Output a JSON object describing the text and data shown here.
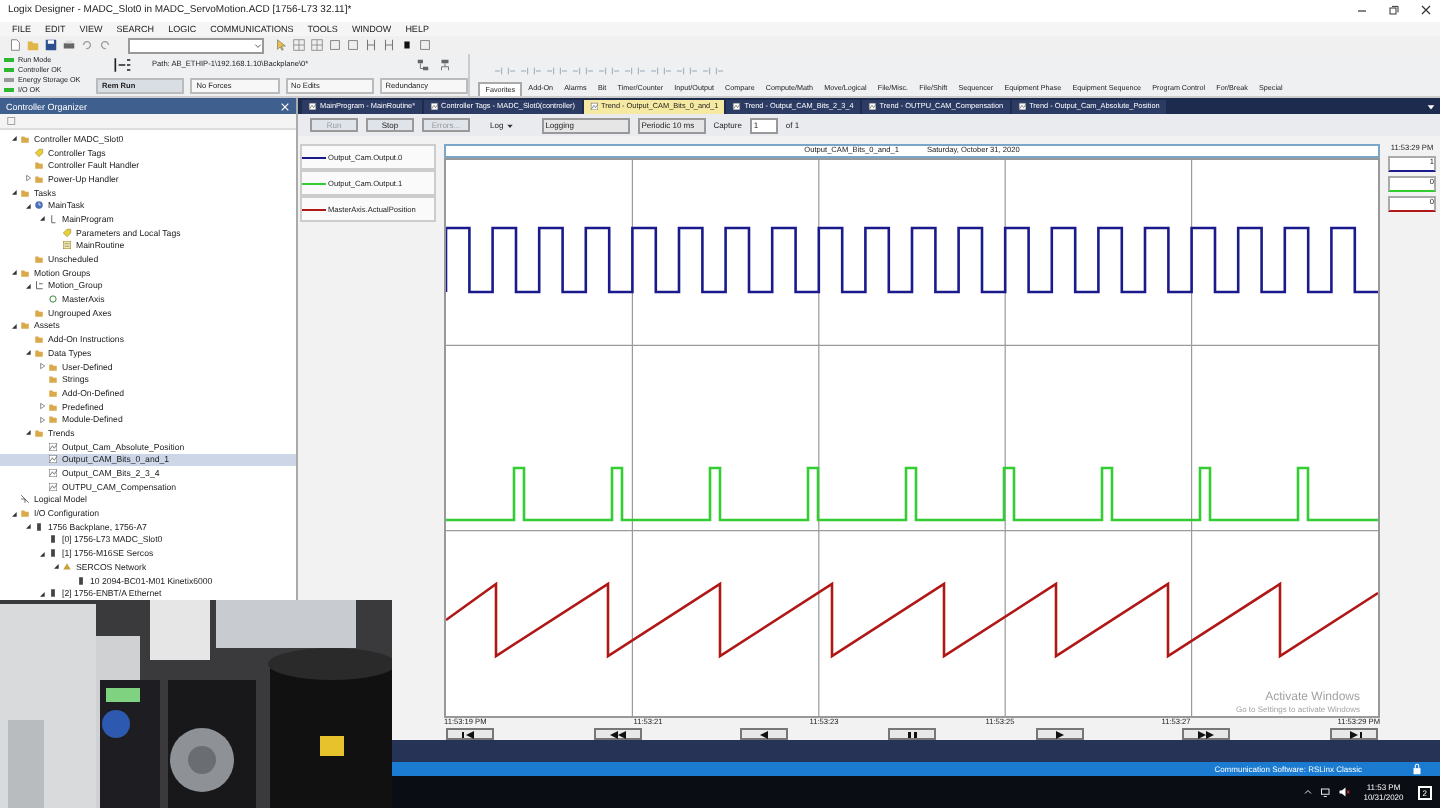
{
  "window": {
    "title": "Logix Designer - MADC_Slot0 in MADC_ServoMotion.ACD [1756-L73 32.11]*"
  },
  "menu": [
    "FILE",
    "EDIT",
    "VIEW",
    "SEARCH",
    "LOGIC",
    "COMMUNICATIONS",
    "TOOLS",
    "WINDOW",
    "HELP"
  ],
  "controller_status": [
    {
      "label": "Run Mode",
      "on": true
    },
    {
      "label": "Controller OK",
      "on": true
    },
    {
      "label": "Energy Storage OK",
      "on": false
    },
    {
      "label": "I/O OK",
      "on": true
    }
  ],
  "path": "Path: AB_ETHIP-1\\192.168.1.10\\Backplane\\0*",
  "mode_indicators": [
    "Rem Run",
    "No Forces",
    "No Edits",
    "Redundancy"
  ],
  "instruction_tabs": [
    {
      "label": "Favorites",
      "selected": true
    },
    {
      "label": "Add-On",
      "selected": false
    },
    {
      "label": "Alarms",
      "selected": false
    },
    {
      "label": "Bit",
      "selected": false
    },
    {
      "label": "Timer/Counter",
      "selected": false
    },
    {
      "label": "Input/Output",
      "selected": false
    },
    {
      "label": "Compare",
      "selected": false
    },
    {
      "label": "Compute/Math",
      "selected": false
    },
    {
      "label": "Move/Logical",
      "selected": false
    },
    {
      "label": "File/Misc.",
      "selected": false
    },
    {
      "label": "File/Shift",
      "selected": false
    },
    {
      "label": "Sequencer",
      "selected": false
    },
    {
      "label": "Equipment Phase",
      "selected": false
    },
    {
      "label": "Equipment Sequence",
      "selected": false
    },
    {
      "label": "Program Control",
      "selected": false
    },
    {
      "label": "For/Break",
      "selected": false
    },
    {
      "label": "Special",
      "selected": false
    }
  ],
  "organizer": {
    "title": "Controller Organizer",
    "tree": [
      {
        "label": "Controller MADC_Slot0",
        "kind": "folder",
        "expanded": true,
        "selected": false,
        "children": [
          {
            "label": "Controller Tags",
            "kind": "tags",
            "selected": false
          },
          {
            "label": "Controller Fault Handler",
            "kind": "folder",
            "selected": false
          },
          {
            "label": "Power-Up Handler",
            "kind": "folder",
            "expanded": false,
            "selected": false
          }
        ]
      },
      {
        "label": "Tasks",
        "kind": "folder",
        "expanded": true,
        "selected": false,
        "children": [
          {
            "label": "MainTask",
            "kind": "task",
            "expanded": true,
            "selected": false,
            "children": [
              {
                "label": "MainProgram",
                "kind": "program",
                "expanded": true,
                "selected": false,
                "children": [
                  {
                    "label": "Parameters and Local Tags",
                    "kind": "tags",
                    "selected": false
                  },
                  {
                    "label": "MainRoutine",
                    "kind": "routine",
                    "selected": false
                  }
                ]
              }
            ]
          },
          {
            "label": "Unscheduled",
            "kind": "folder",
            "selected": false
          }
        ]
      },
      {
        "label": "Motion Groups",
        "kind": "folder",
        "expanded": true,
        "selected": false,
        "children": [
          {
            "label": "Motion_Group",
            "kind": "group",
            "expanded": true,
            "selected": false,
            "children": [
              {
                "label": "MasterAxis",
                "kind": "axis",
                "selected": false
              }
            ]
          },
          {
            "label": "Ungrouped Axes",
            "kind": "folder",
            "selected": false
          }
        ]
      },
      {
        "label": "Assets",
        "kind": "folder",
        "expanded": true,
        "selected": false,
        "children": [
          {
            "label": "Add-On Instructions",
            "kind": "folder",
            "selected": false
          },
          {
            "label": "Data Types",
            "kind": "folder",
            "expanded": true,
            "selected": false,
            "children": [
              {
                "label": "User-Defined",
                "kind": "folder",
                "expanded": false,
                "selected": false
              },
              {
                "label": "Strings",
                "kind": "folder",
                "selected": false
              },
              {
                "label": "Add-On-Defined",
                "kind": "folder",
                "selected": false
              },
              {
                "label": "Predefined",
                "kind": "folder",
                "expanded": false,
                "selected": false
              },
              {
                "label": "Module-Defined",
                "kind": "folder",
                "expanded": false,
                "selected": false
              }
            ]
          },
          {
            "label": "Trends",
            "kind": "folder",
            "expanded": true,
            "selected": false,
            "children": [
              {
                "label": "Output_Cam_Absolute_Position",
                "kind": "trend",
                "selected": false
              },
              {
                "label": "Output_CAM_Bits_0_and_1",
                "kind": "trend",
                "selected": true
              },
              {
                "label": "Output_CAM_Bits_2_3_4",
                "kind": "trend",
                "selected": false
              },
              {
                "label": "OUTPU_CAM_Compensation",
                "kind": "trend",
                "selected": false
              }
            ]
          }
        ]
      },
      {
        "label": "Logical Model",
        "kind": "model",
        "selected": false
      },
      {
        "label": "I/O Configuration",
        "kind": "folder",
        "expanded": true,
        "selected": false,
        "children": [
          {
            "label": "1756 Backplane, 1756-A7",
            "kind": "module",
            "expanded": true,
            "selected": false,
            "children": [
              {
                "label": "[0] 1756-L73 MADC_Slot0",
                "kind": "module",
                "selected": false
              },
              {
                "label": "[1] 1756-M16SE Sercos",
                "kind": "module",
                "expanded": true,
                "selected": false,
                "children": [
                  {
                    "label": "SERCOS Network",
                    "kind": "network",
                    "expanded": true,
                    "selected": false,
                    "children": [
                      {
                        "label": "10 2094-BC01-M01 Kinetix6000",
                        "kind": "module",
                        "selected": false
                      }
                    ]
                  }
                ]
              },
              {
                "label": "[2] 1756-ENBT/A Ethernet",
                "kind": "module",
                "expanded": true,
                "selected": false
              }
            ]
          }
        ]
      }
    ]
  },
  "editor_tabs": [
    {
      "label": "MainProgram - MainRoutine*",
      "selected": false
    },
    {
      "label": "Controller Tags - MADC_Slot0(controller)",
      "selected": false
    },
    {
      "label": "Trend - Output_CAM_Bits_0_and_1",
      "selected": true
    },
    {
      "label": "Trend - Output_CAM_Bits_2_3_4",
      "selected": false
    },
    {
      "label": "Trend - OUTPU_CAM_Compensation",
      "selected": false
    },
    {
      "label": "Trend - Output_Cam_Absolute_Position",
      "selected": false
    }
  ],
  "trend_toolbar": {
    "run": {
      "label": "Run",
      "disabled": true
    },
    "stop": {
      "label": "Stop",
      "disabled": false
    },
    "errors": {
      "label": "Errors...",
      "disabled": true
    },
    "log": "Log",
    "logging": "Logging",
    "rate": "Periodic 10 ms",
    "capture_label": "Capture",
    "capture": "1",
    "capture_of": "of 1"
  },
  "trend": {
    "header_name": "Output_CAM_Bits_0_and_1",
    "header_date": "Saturday, October 31, 2020",
    "cursor_time": "11:53:29 PM",
    "pens": [
      {
        "name": "Output_Cam.Output.0",
        "color": "#1a1a8c",
        "kind": "square",
        "value": "1"
      },
      {
        "name": "Output_Cam.Output.1",
        "color": "#33cc33",
        "kind": "pulse",
        "value": "0"
      },
      {
        "name": "MasterAxis.ActualPosition",
        "color": "#b01818",
        "kind": "sawtooth",
        "value": "0"
      }
    ],
    "time_labels": [
      "11:53:19 PM",
      "11:53:21",
      "11:53:23",
      "11:53:25",
      "11:53:27",
      "11:53:29 PM"
    ]
  },
  "activation": {
    "title": "Activate Windows",
    "hint": "Go to Settings to activate Windows"
  },
  "status_bar": "Communication Software: RSLinx Classic",
  "taskbar": {
    "time": "11:53 PM",
    "date": "10/31/2020",
    "notifications": "2"
  }
}
